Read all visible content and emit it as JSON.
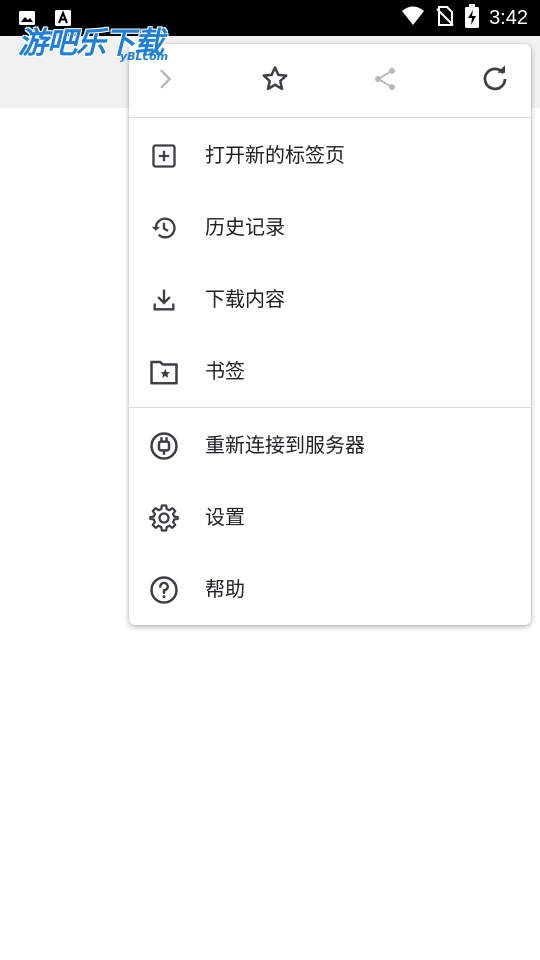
{
  "status_bar": {
    "time": "3:42",
    "left_icons": [
      "image-icon",
      "text-a-icon"
    ],
    "right_icons": [
      "wifi-icon",
      "no-sim-icon",
      "battery-charging-icon"
    ]
  },
  "watermark": {
    "main": "游吧乐下载",
    "sub": "yBLcom"
  },
  "menu": {
    "top_actions": [
      {
        "name": "forward",
        "icon": "chevron-right-icon",
        "enabled": false
      },
      {
        "name": "bookmark",
        "icon": "star-outline-icon",
        "enabled": true
      },
      {
        "name": "share",
        "icon": "share-icon",
        "enabled": false
      },
      {
        "name": "reload",
        "icon": "refresh-icon",
        "enabled": true
      }
    ],
    "items": [
      {
        "label": "打开新的标签页",
        "icon": "add-box-icon"
      },
      {
        "label": "历史记录",
        "icon": "history-icon"
      },
      {
        "label": "下载内容",
        "icon": "download-icon"
      },
      {
        "label": "书签",
        "icon": "bookmark-folder-icon"
      },
      {
        "label": "重新连接到服务器",
        "icon": "plug-icon"
      },
      {
        "label": "设置",
        "icon": "gear-icon"
      },
      {
        "label": "帮助",
        "icon": "help-icon"
      }
    ]
  },
  "colors": {
    "status_bar": "#000000",
    "toolbar": "#f1f1f1",
    "icon_enabled": "#3c4043",
    "icon_disabled": "#b8b8b8",
    "text": "#202124",
    "watermark": "#1e7fd8"
  }
}
